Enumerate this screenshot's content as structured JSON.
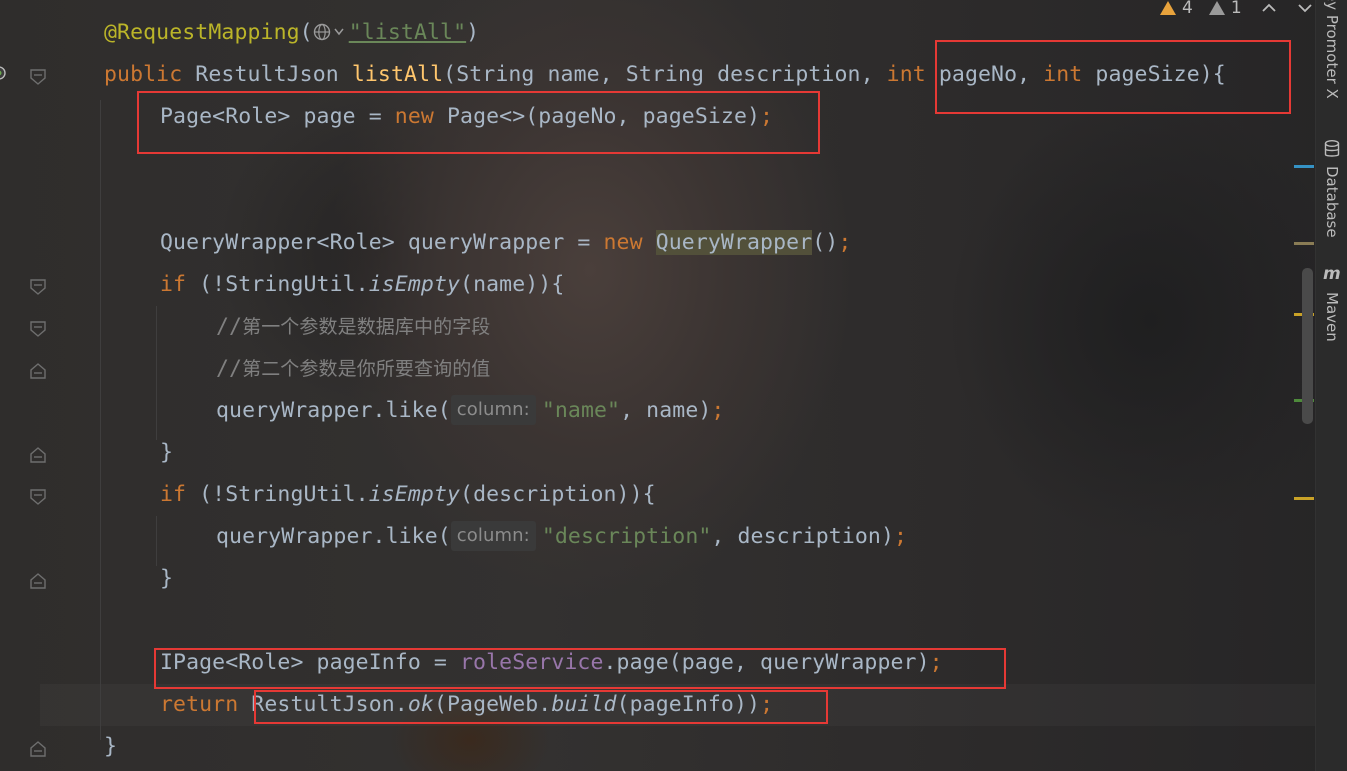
{
  "inspection": {
    "warnings_count": "4",
    "weak_warnings_count": "1",
    "prev_icon": "chevron-up-icon",
    "next_icon": "chevron-down-icon"
  },
  "tool_windows": [
    {
      "label": "ey Promoter X",
      "icon": "promoter-icon"
    },
    {
      "label": "Database",
      "icon": "database-icon"
    },
    {
      "label": "Maven",
      "icon": "maven-icon"
    }
  ],
  "code": {
    "l1": {
      "annotation": "@RequestMapping",
      "paren_open": "(",
      "string": "\"listAll\"",
      "paren_close": ")"
    },
    "l2": {
      "public": "public",
      "type": " RestultJson ",
      "method": "listAll",
      "params_a": "(String name, String description,",
      "int1": " int",
      "p1": " pageNo,",
      "int2": " int",
      "p2": " pageSize){"
    },
    "l3": {
      "a": "Page<Role> page = ",
      "new": "new",
      "b": " Page<>(pageNo, pageSize)",
      "semi": ";"
    },
    "l6": {
      "a": "QueryWrapper<Role> queryWrapper = ",
      "new": "new",
      "sp": " ",
      "cls": "QueryWrapper",
      "b": "()",
      "semi": ";"
    },
    "l7": {
      "if": "if",
      "a": " (!StringUtil.",
      "m": "isEmpty",
      "b": "(name)){"
    },
    "l8": {
      "slashes": "//",
      "text": "第一个参数是数据库中的字段"
    },
    "l9": {
      "slashes": "//",
      "text": "第二个参数是你所要查询的值"
    },
    "l10": {
      "a": "queryWrapper.like(",
      "hint": "column:",
      "str": "\"name\"",
      "b": ", name)",
      "semi": ";"
    },
    "l11": {
      "a": "}"
    },
    "l12": {
      "if": "if",
      "a": " (!StringUtil.",
      "m": "isEmpty",
      "b": "(description)){"
    },
    "l13": {
      "a": "queryWrapper.like(",
      "hint": "column:",
      "str": "\"description\"",
      "b": ", description)",
      "semi": ";"
    },
    "l14": {
      "a": "}"
    },
    "l16": {
      "a": "IPage<Role> pageInfo = ",
      "fld": "roleService",
      "b": ".page(page, queryWrapper)",
      "semi": ";"
    },
    "l17": {
      "ret": "return",
      "a": " RestultJson.",
      "ok": "ok",
      "b": "(PageWeb.",
      "build": "build",
      "c": "(pageInfo))",
      "semi": ";"
    },
    "l18": {
      "a": "}"
    }
  },
  "colors": {
    "keyword": "#cc7832",
    "annotation": "#bbb529",
    "string": "#6a8759",
    "method_decl": "#ffc66d",
    "field": "#9876aa",
    "comment": "#808080",
    "default_text": "#a9b7c6",
    "highlight_box": "#e53935"
  }
}
